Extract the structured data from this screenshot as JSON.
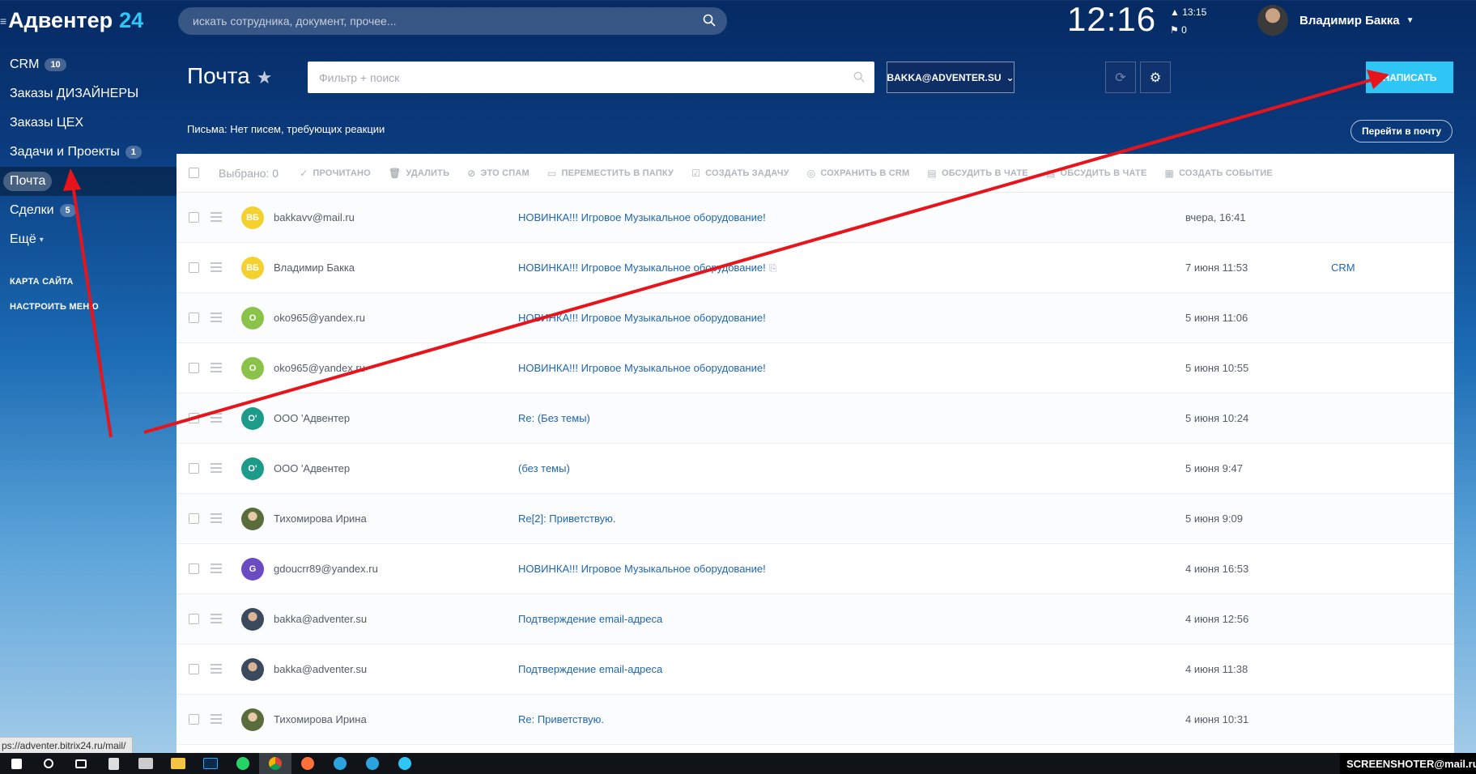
{
  "brand": {
    "name": "Адвентер",
    "number": "24"
  },
  "sidebar": {
    "items": [
      {
        "label": "CRM",
        "counter": "10"
      },
      {
        "label": "Заказы ДИЗАЙНЕРЫ",
        "counter": ""
      },
      {
        "label": "Заказы ЦЕХ",
        "counter": ""
      },
      {
        "label": "Задачи и Проекты",
        "counter": "1"
      },
      {
        "label": "Почта",
        "counter": "",
        "active": true
      },
      {
        "label": "Сделки",
        "counter": "5"
      },
      {
        "label": "Ещё",
        "counter": ""
      }
    ],
    "links": [
      "КАРТА САЙТА",
      "НАСТРОИТЬ МЕНЮ"
    ]
  },
  "header": {
    "search_placeholder": "искать сотрудника, документ, прочее...",
    "clock": "12:16",
    "stat_time": "13:15",
    "stat_count": "0",
    "user_name": "Владимир Бакка"
  },
  "page": {
    "title": "Почта",
    "filter_placeholder": "Фильтр + поиск",
    "mailbox": "BAKKA@ADVENTER.SU",
    "compose_label": "НАПИСАТЬ",
    "notice": "Письма: Нет писем, требующих реакции",
    "go_to_mail": "Перейти в почту"
  },
  "toolbar": {
    "selected": "Выбрано: 0",
    "read": "ПРОЧИТАНО",
    "delete": "УДАЛИТЬ",
    "spam": "ЭТО СПАМ",
    "move": "ПЕРЕМЕСТИТЬ В ПАПКУ",
    "task": "СОЗДАТЬ ЗАДАЧУ",
    "save_crm": "СОХРАНИТЬ В CRM",
    "discuss_chat": "ОБСУДИТЬ В ЧАТЕ",
    "discuss_chat2": "ОБСУДИТЬ В ЧАТЕ",
    "event": "СОЗДАТЬ СОБЫТИЕ"
  },
  "messages": [
    {
      "initials": "ВБ",
      "color": "#f5d130",
      "sender": "bakkavv@mail.ru",
      "subject": "НОВИНКА!!! Игровое Музыкальное оборудование!",
      "date": "вчера, 16:41",
      "crm": ""
    },
    {
      "initials": "ВБ",
      "color": "#f5d130",
      "sender": "Владимир Бакка",
      "subject": "НОВИНКА!!! Игровое Музыкальное оборудование!",
      "date": "7 июня 11:53",
      "crm": "CRM",
      "clip": true
    },
    {
      "initials": "O",
      "color": "#8bc34a",
      "sender": "oko965@yandex.ru",
      "subject": "НОВИНКА!!! Игровое Музыкальное оборудование!",
      "date": "5 июня 11:06",
      "crm": ""
    },
    {
      "initials": "O",
      "color": "#8bc34a",
      "sender": "oko965@yandex.ru",
      "subject": "НОВИНКА!!! Игровое Музыкальное оборудование!",
      "date": "5 июня 10:55",
      "crm": ""
    },
    {
      "initials": "O'",
      "color": "#1c9b8a",
      "sender": "ООО 'Адвентер",
      "subject": "Re: (Без темы)",
      "date": "5 июня 10:24",
      "crm": ""
    },
    {
      "initials": "O'",
      "color": "#1c9b8a",
      "sender": "ООО 'Адвентер",
      "subject": "(без темы)",
      "date": "5 июня 9:47",
      "crm": ""
    },
    {
      "initials": "",
      "color": "photo",
      "sender": "Тихомирова Ирина",
      "subject": "Re[2]: Приветствую.",
      "date": "5 июня 9:09",
      "crm": ""
    },
    {
      "initials": "G",
      "color": "#6a4bc2",
      "sender": "gdoucrr89@yandex.ru",
      "subject": "НОВИНКА!!! Игровое Музыкальное оборудование!",
      "date": "4 июня 16:53",
      "crm": ""
    },
    {
      "initials": "",
      "color": "photo2",
      "sender": "bakka@adventer.su",
      "subject": "Подтверждение email-адреса",
      "date": "4 июня 12:56",
      "crm": ""
    },
    {
      "initials": "",
      "color": "photo2",
      "sender": "bakka@adventer.su",
      "subject": "Подтверждение email-адреса",
      "date": "4 июня 11:38",
      "crm": ""
    },
    {
      "initials": "",
      "color": "photo",
      "sender": "Тихомирова Ирина",
      "subject": "Re: Приветствую.",
      "date": "4 июня 10:31",
      "crm": ""
    }
  ],
  "status_url": "ps://adventer.bitrix24.ru/mail/",
  "watermark": "SCREENSHOTER@mail.ru"
}
